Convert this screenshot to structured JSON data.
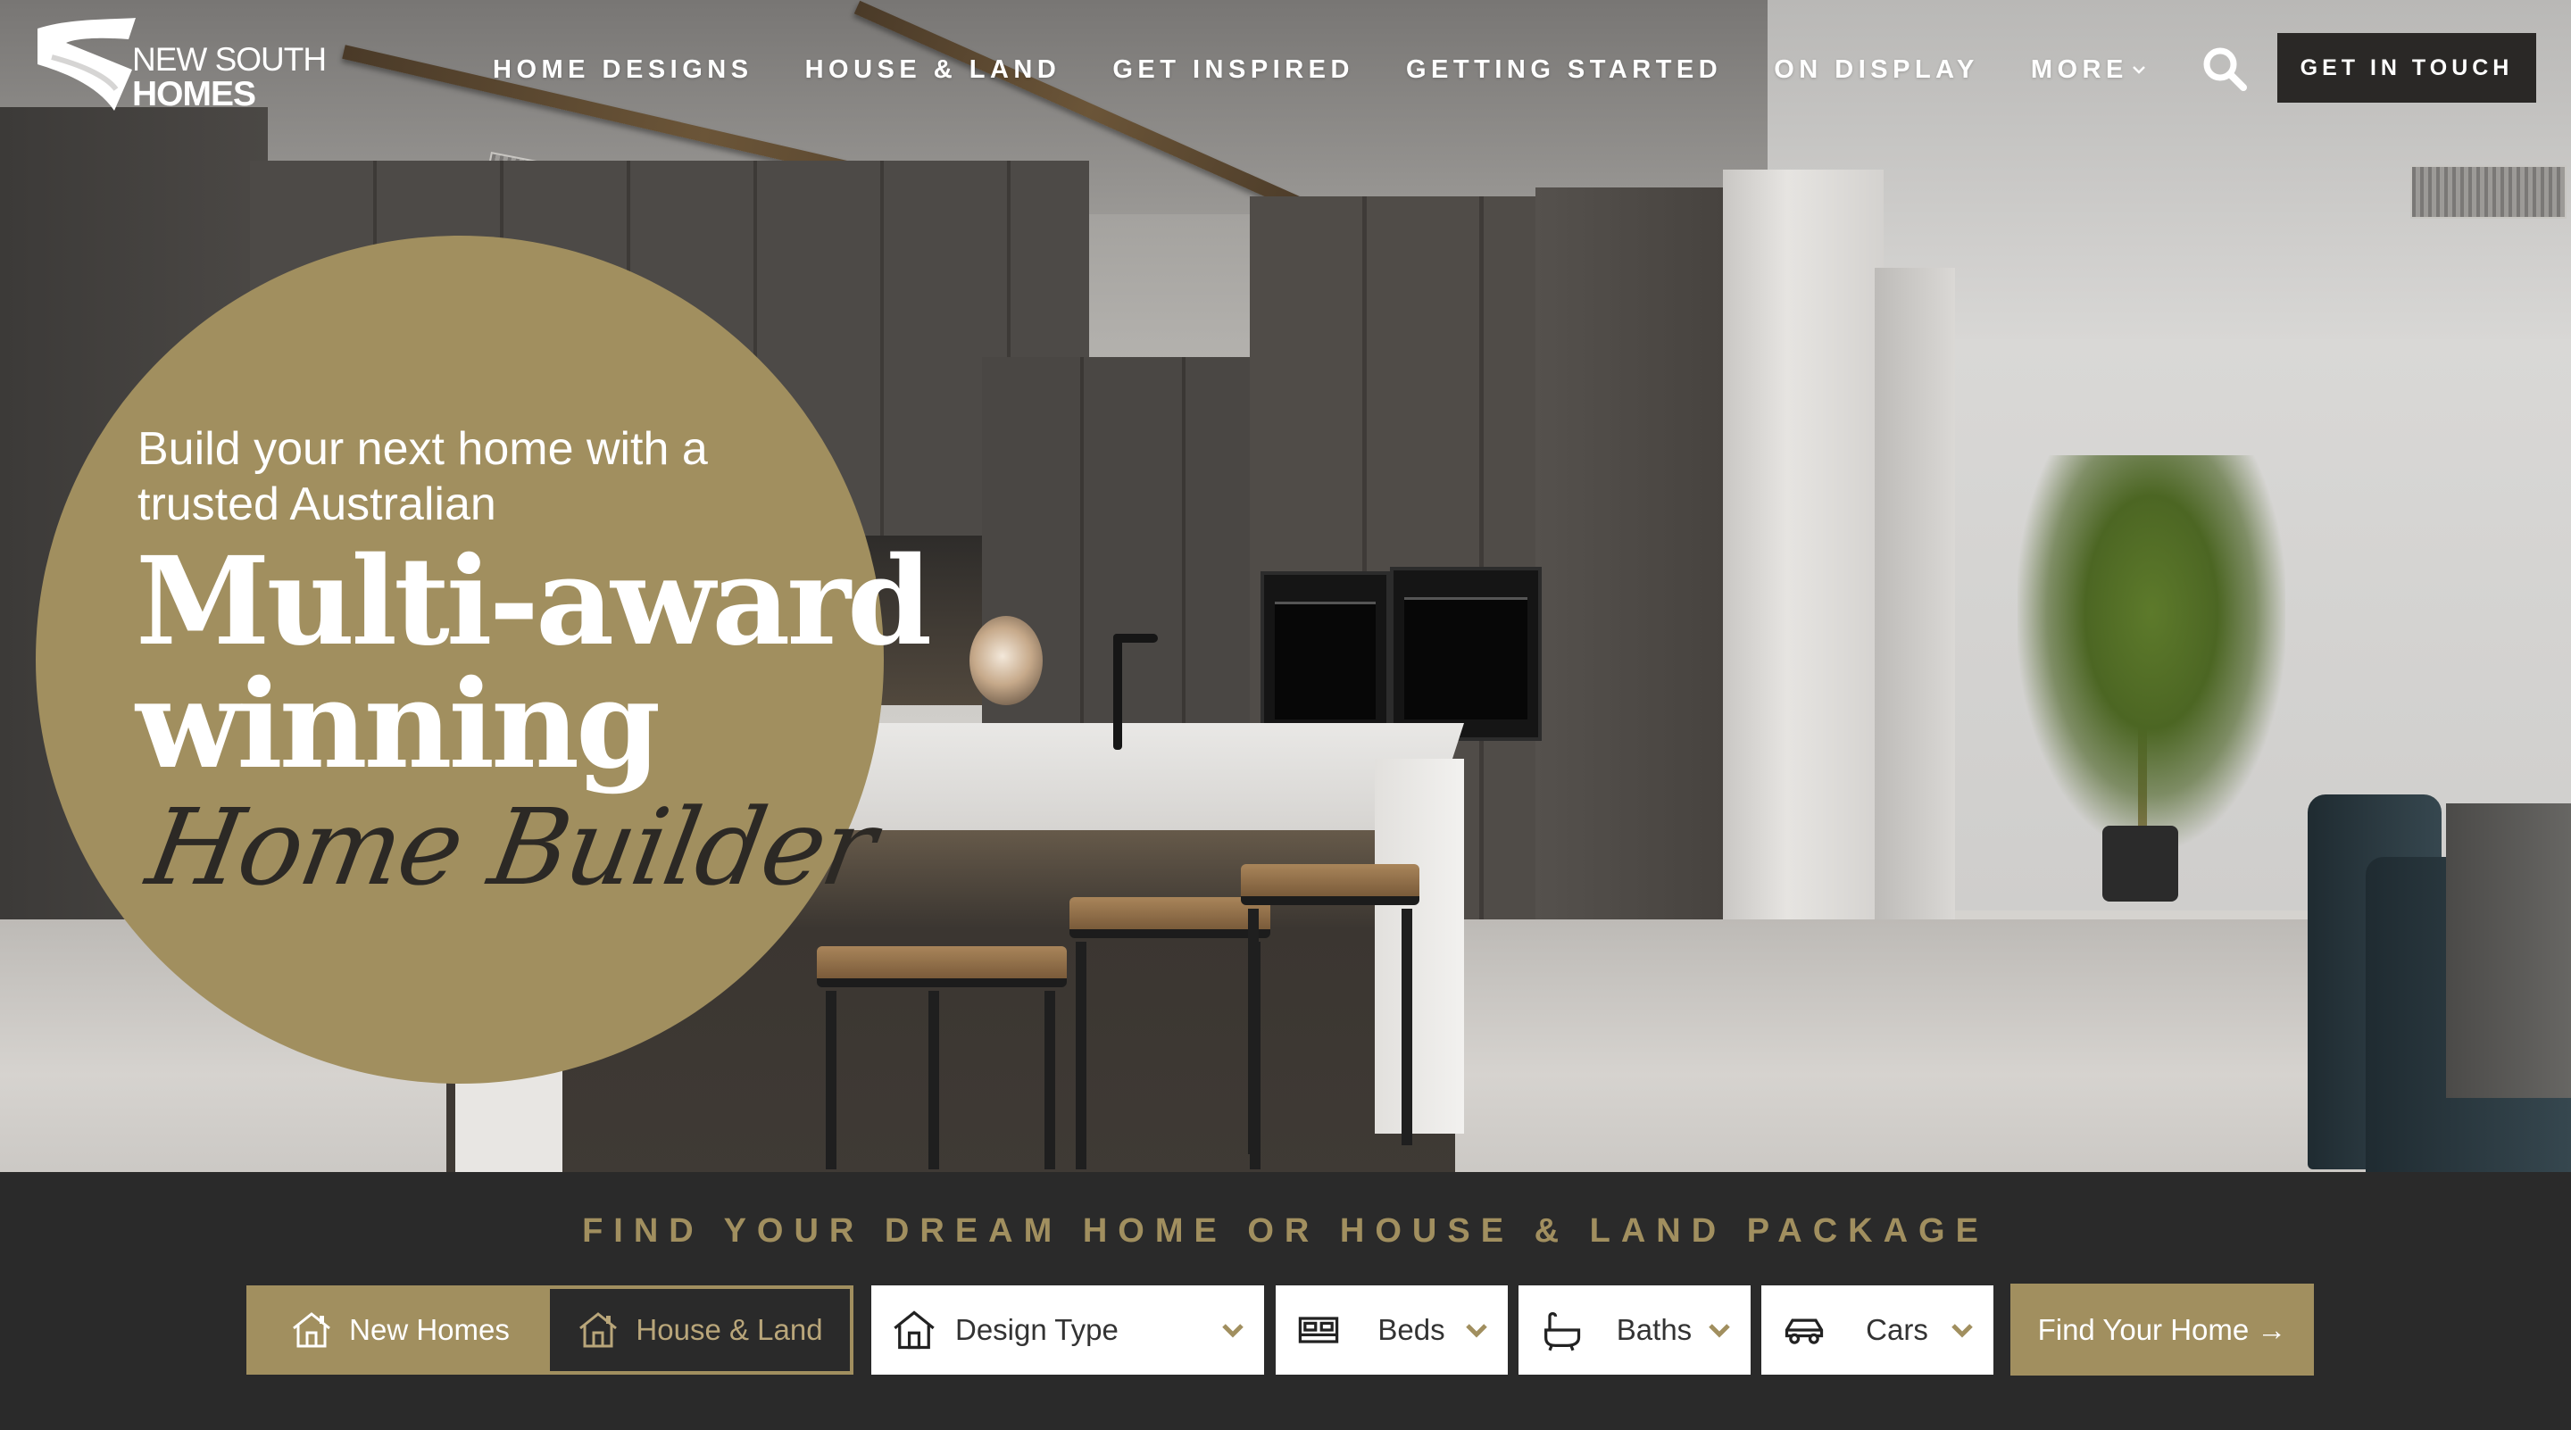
{
  "brand": {
    "name_line1": "NEW SOUTH",
    "name_line2": "HOMES",
    "accent_color": "#a18f5f",
    "dark_color": "#2a2a2a"
  },
  "nav": {
    "items": [
      {
        "label": "HOME DESIGNS"
      },
      {
        "label": "HOUSE & LAND"
      },
      {
        "label": "GET INSPIRED"
      },
      {
        "label": "GETTING STARTED"
      },
      {
        "label": "ON DISPLAY"
      },
      {
        "label": "MORE",
        "icon": "chevron-down-icon"
      }
    ],
    "search_icon": "search-icon",
    "cta_label": "GET IN TOUCH"
  },
  "hero": {
    "tagline": "Build your next home with a trusted Australian",
    "headline_line1": "Multi-award",
    "headline_line2": "winning",
    "script_text": "Home Builder"
  },
  "finder": {
    "title": "FIND YOUR DREAM HOME OR HOUSE & LAND PACKAGE",
    "toggle": [
      {
        "label": "New Homes",
        "icon": "house-icon",
        "active": true
      },
      {
        "label": "House & Land",
        "icon": "house-icon",
        "active": false
      }
    ],
    "selects": [
      {
        "label": "Design Type",
        "icon": "house-icon"
      },
      {
        "label": "Beds",
        "icon": "bed-icon"
      },
      {
        "label": "Baths",
        "icon": "bath-icon"
      },
      {
        "label": "Cars",
        "icon": "car-icon"
      }
    ],
    "submit_label": "Find Your Home →"
  }
}
